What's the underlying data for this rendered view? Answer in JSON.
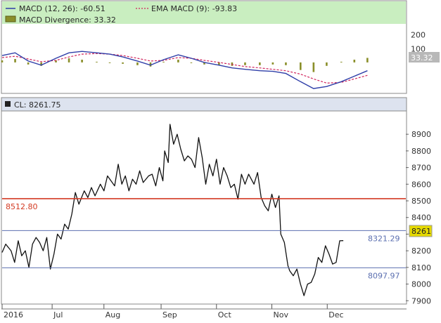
{
  "chart_data": [
    {
      "type": "line",
      "name": "macd-panel",
      "legend": {
        "macd_label": "MACD (12, 26): -60.51",
        "ema_label": "EMA MACD (9): -93.83",
        "divergence_label": "MACD Divergence: 33.32"
      },
      "colors": {
        "macd": "#2e3ea8",
        "ema": "#d0245c",
        "divergence": "#8a8f2a",
        "legend_bg": "#c9eec0"
      },
      "ylim": [
        -220,
        270
      ],
      "ytick_values": [
        200,
        100
      ],
      "ytick_labels": [
        "200",
        "100"
      ],
      "last_value_badge": "33.32",
      "x": [
        0,
        8,
        16,
        24,
        33,
        41,
        49,
        58,
        66,
        74,
        83,
        91,
        99,
        108,
        116,
        124,
        133,
        141,
        149,
        158,
        166,
        174,
        183,
        191,
        199,
        208,
        216,
        224
      ],
      "macd": [
        50,
        70,
        10,
        -20,
        30,
        70,
        80,
        70,
        60,
        40,
        10,
        -20,
        20,
        55,
        30,
        0,
        -20,
        -40,
        -50,
        -60,
        -65,
        -80,
        -140,
        -190,
        -175,
        -140,
        -100,
        -60
      ],
      "ema": [
        35,
        45,
        25,
        5,
        15,
        40,
        60,
        65,
        60,
        50,
        30,
        10,
        15,
        35,
        30,
        15,
        0,
        -15,
        -30,
        -40,
        -50,
        -60,
        -85,
        -120,
        -150,
        -145,
        -120,
        -94
      ],
      "divergence": [
        15,
        25,
        -15,
        -25,
        15,
        30,
        20,
        5,
        0,
        -10,
        -20,
        -30,
        5,
        20,
        0,
        -15,
        -20,
        -25,
        -20,
        -20,
        -15,
        -20,
        -55,
        -70,
        -25,
        5,
        20,
        33
      ]
    },
    {
      "type": "line",
      "name": "price-panel",
      "title": "CL: 8261.75",
      "colors": {
        "price": "#111111",
        "resistance": "#d33a22",
        "support": "#5b6fb0",
        "badge": "#e5d900",
        "title_bg": "#dde3ef"
      },
      "ylim": [
        7880,
        9040
      ],
      "ytick_values": [
        8900,
        8800,
        8700,
        8600,
        8500,
        8400,
        8300,
        8200,
        8100,
        8000,
        7900
      ],
      "ytick_labels": [
        "8900",
        "8800",
        "8700",
        "8600",
        "8500",
        "8400",
        "8300",
        "8200",
        "8100",
        "8000",
        "7900"
      ],
      "x_categories": [
        "2016",
        "Jul",
        "Aug",
        "Sep",
        "Oct",
        "Nov",
        "Dec"
      ],
      "x_category_positions": [
        0,
        28,
        57,
        89,
        120,
        151,
        182
      ],
      "xlim": [
        0,
        226
      ],
      "levels": [
        {
          "value": 8512.8,
          "label": "8512.80",
          "side": "left",
          "kind": "resistance"
        },
        {
          "value": 8321.29,
          "label": "8321.29",
          "side": "right",
          "kind": "support"
        },
        {
          "value": 8097.97,
          "label": "8097.97",
          "side": "right",
          "kind": "support"
        }
      ],
      "last_value_badge": "8261",
      "x": [
        0,
        2,
        5,
        7,
        9,
        11,
        13,
        15,
        17,
        19,
        21,
        23,
        25,
        27,
        29,
        31,
        33,
        35,
        37,
        39,
        41,
        43,
        46,
        48,
        50,
        52,
        55,
        57,
        59,
        61,
        63,
        65,
        67,
        69,
        71,
        73,
        75,
        77,
        79,
        82,
        84,
        86,
        88,
        90,
        91,
        93,
        94,
        96,
        98,
        100,
        102,
        104,
        106,
        108,
        110,
        112,
        114,
        116,
        118,
        120,
        122,
        124,
        126,
        128,
        130,
        132,
        134,
        136,
        138,
        141,
        143,
        145,
        147,
        149,
        151,
        153,
        155,
        156,
        158,
        160,
        161,
        163,
        165,
        167,
        169,
        171,
        173,
        175,
        177,
        179,
        181,
        183,
        185,
        187,
        189,
        191
      ],
      "y": [
        8190,
        8240,
        8200,
        8130,
        8260,
        8170,
        8200,
        8100,
        8240,
        8280,
        8250,
        8200,
        8280,
        8090,
        8180,
        8300,
        8270,
        8360,
        8330,
        8420,
        8550,
        8480,
        8560,
        8520,
        8580,
        8530,
        8600,
        8560,
        8650,
        8620,
        8590,
        8720,
        8600,
        8650,
        8560,
        8630,
        8600,
        8680,
        8610,
        8650,
        8660,
        8590,
        8700,
        8620,
        8800,
        8730,
        8960,
        8840,
        8900,
        8810,
        8740,
        8770,
        8750,
        8700,
        8880,
        8760,
        8600,
        8720,
        8650,
        8750,
        8600,
        8700,
        8650,
        8580,
        8600,
        8510,
        8660,
        8600,
        8660,
        8600,
        8670,
        8520,
        8470,
        8440,
        8540,
        8460,
        8530,
        8300,
        8250,
        8110,
        8080,
        8050,
        8090,
        8000,
        7930,
        8000,
        8010,
        8060,
        8160,
        8130,
        8230,
        8180,
        8120,
        8130,
        8260,
        8261
      ]
    }
  ]
}
